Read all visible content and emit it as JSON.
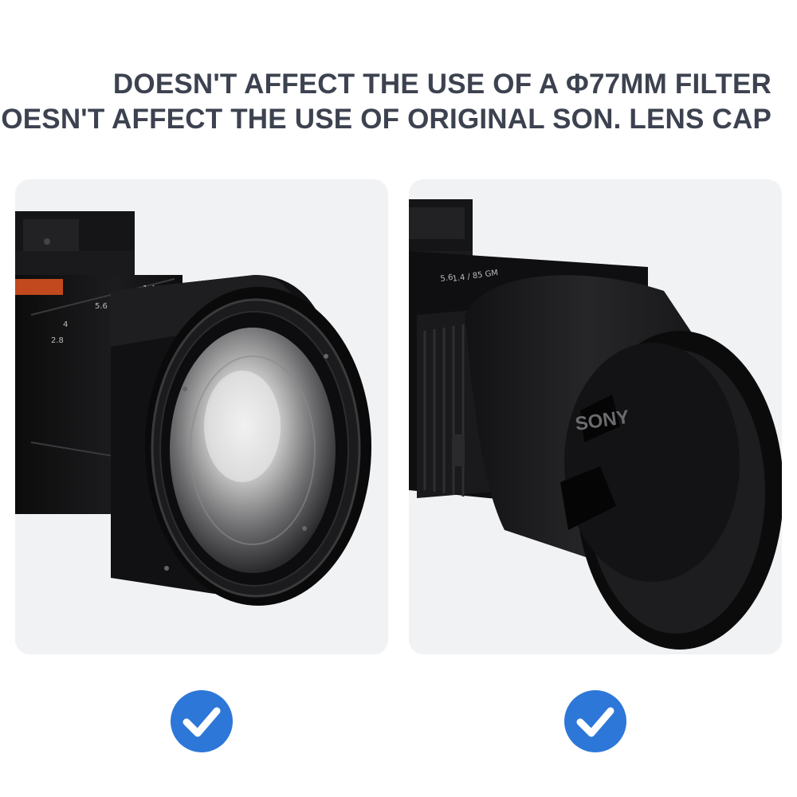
{
  "headline": {
    "line1": "DOESN'T AFFECT THE USE OF A Φ77MM FILTER",
    "line2": "DOESN'T AFFECT THE USE OF ORIGINAL SON. LENS CAP"
  },
  "panels": [
    {
      "subject": "camera-lens-with-hood-and-77mm-filter"
    },
    {
      "subject": "camera-lens-with-hood-and-original-lens-cap",
      "cap_logo": "SONY"
    }
  ],
  "badges": [
    {
      "icon": "checkmark-icon",
      "status": "supported"
    },
    {
      "icon": "checkmark-icon",
      "status": "supported"
    }
  ],
  "colors": {
    "headline_text": "#3d4250",
    "panel_background": "#f1f2f4",
    "check_badge": "#2d77d8"
  }
}
